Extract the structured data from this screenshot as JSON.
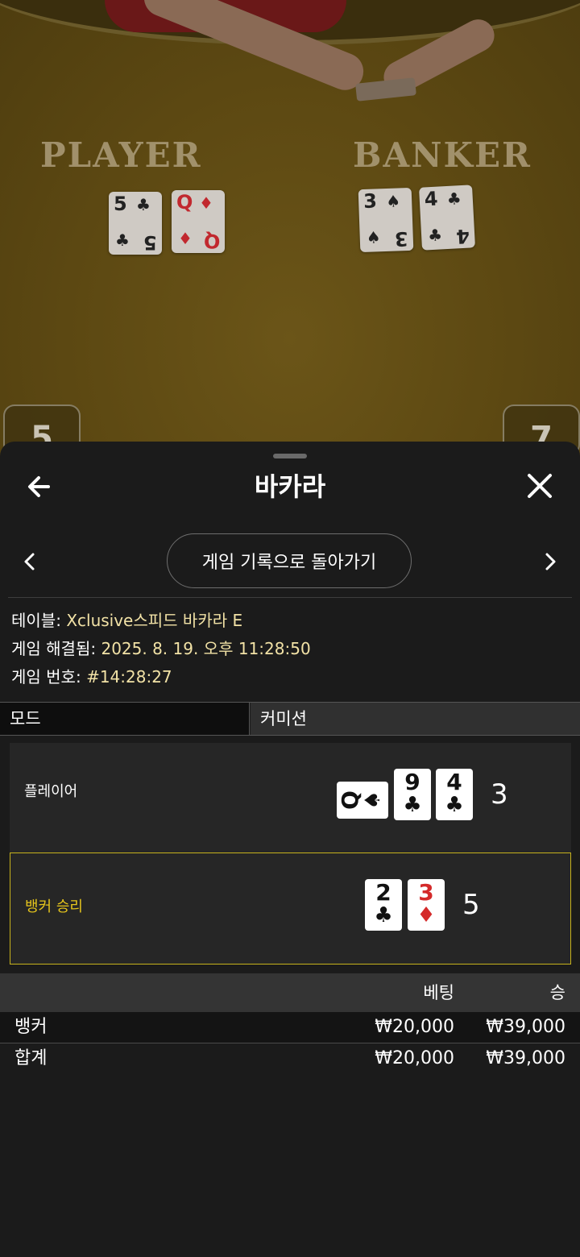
{
  "video": {
    "felt_labels": {
      "player": "PLAYER",
      "banker": "BANKER"
    },
    "player_cards": [
      {
        "rank": "5",
        "suit": "♣",
        "color": "black"
      },
      {
        "rank": "Q",
        "suit": "♦",
        "color": "red"
      }
    ],
    "banker_cards": [
      {
        "rank": "3",
        "suit": "♠",
        "color": "black"
      },
      {
        "rank": "4",
        "suit": "♣",
        "color": "black"
      }
    ],
    "score_left": "5",
    "score_right": "7"
  },
  "sheet": {
    "title": "바카라",
    "back_icon": "arrow-left-icon",
    "close_icon": "close-icon",
    "return_button": "게임 기록으로 돌아가기",
    "info": {
      "table_key": "테이블:",
      "table_value": "Xclusive스피드 바카라 E",
      "resolved_key": "게임 해결됨:",
      "resolved_value": "2025. 8. 19. 오후 11:28:50",
      "game_no_key": "게임 번호:",
      "game_no_value": "#14:28:27"
    },
    "tabs": {
      "mode": "모드",
      "commission": "커미션"
    },
    "result": {
      "player_label": "플레이어",
      "player_score": "3",
      "player_cards": [
        {
          "rank": "Q",
          "suit": "♠",
          "color": "black",
          "sideways": true
        },
        {
          "rank": "9",
          "suit": "♣",
          "color": "black"
        },
        {
          "rank": "4",
          "suit": "♣",
          "color": "black"
        }
      ],
      "banker_label": "뱅커 승리",
      "banker_score": "5",
      "banker_cards": [
        {
          "rank": "2",
          "suit": "♣",
          "color": "black"
        },
        {
          "rank": "3",
          "suit": "♦",
          "color": "red"
        }
      ],
      "highlight_color": "#c7b21c"
    },
    "bets": {
      "headers": {
        "bet": "베팅",
        "win": "승"
      },
      "rows": [
        {
          "label": "뱅커",
          "bet": "₩20,000",
          "win": "₩39,000"
        },
        {
          "label": "합계",
          "bet": "₩20,000",
          "win": "₩39,000"
        }
      ]
    }
  }
}
